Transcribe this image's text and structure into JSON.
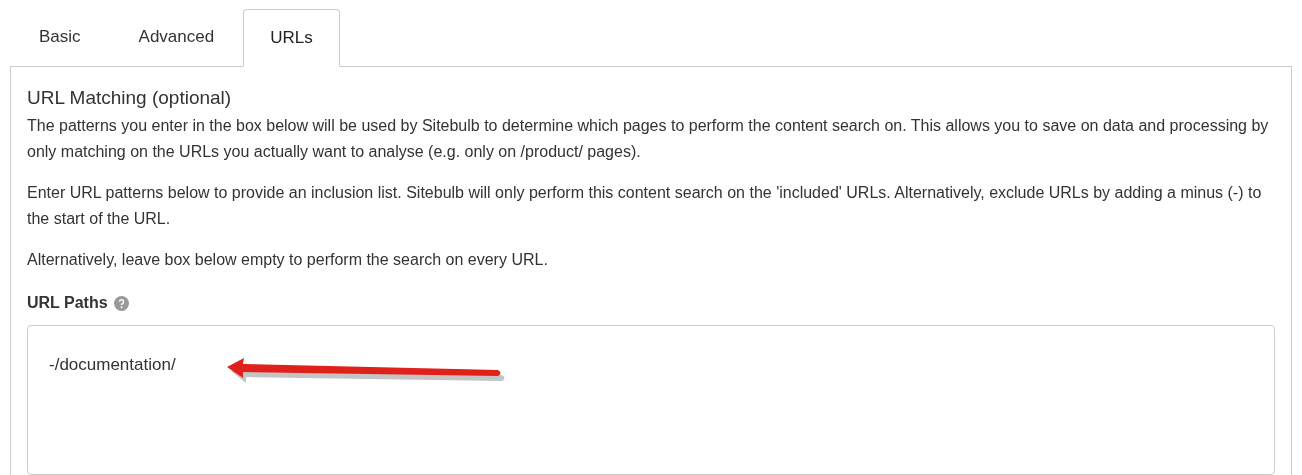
{
  "tabs": [
    {
      "label": "Basic",
      "selected": false
    },
    {
      "label": "Advanced",
      "selected": false
    },
    {
      "label": "URLs",
      "selected": true
    }
  ],
  "section": {
    "title": "URL Matching (optional)",
    "paragraphs": [
      "The patterns you enter in the box below will be used by Sitebulb to determine which pages to perform the content search on. This allows you to save on data and processing by only matching on the URLs you actually want to analyse (e.g. only on /product/ pages).",
      "Enter URL patterns below to provide an inclusion list. Sitebulb will only perform this content search on the 'included' URLs. Alternatively, exclude URLs by adding a minus (-) to the start of the URL.",
      "Alternatively, leave box below empty to perform the search on every URL."
    ]
  },
  "field": {
    "label": "URL Paths",
    "value": "-/documentation/"
  }
}
